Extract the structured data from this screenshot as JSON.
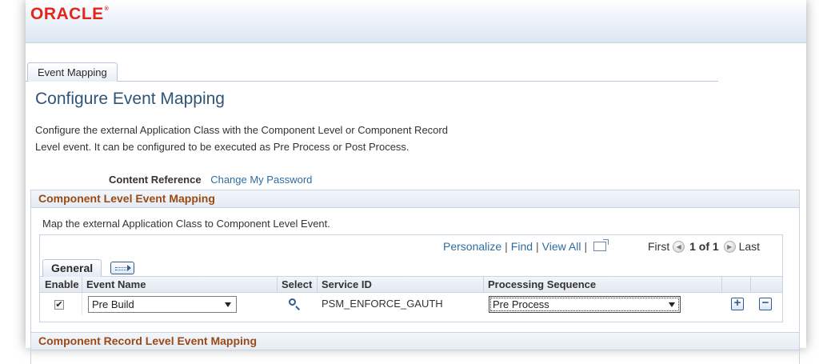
{
  "header": {
    "logo": "ORACLE",
    "logo_mark": "®"
  },
  "tabs": {
    "event_mapping": "Event Mapping"
  },
  "page": {
    "title": "Configure Event Mapping",
    "description": "Configure the external Application Class with the Component Level or Component Record Level event. It can be configured to be executed as Pre Process or Post Process.",
    "content_reference_label": "Content Reference",
    "content_reference_value": "Change My Password"
  },
  "component_level": {
    "title": "Component Level Event Mapping",
    "description": "Map the external Application Class to Component Level Event.",
    "grid": {
      "nav": {
        "personalize": "Personalize",
        "find": "Find",
        "view_all": "View All",
        "sep": "|",
        "first": "First",
        "count": "1 of 1",
        "last": "Last"
      },
      "tab_general": "General",
      "columns": {
        "enable": "Enable",
        "event_name": "Event Name",
        "select": "Select",
        "service_id": "Service ID",
        "processing_sequence": "Processing Sequence"
      },
      "rows": [
        {
          "enabled": "✔",
          "event_name": "Pre Build",
          "service_id": "PSM_ENFORCE_GAUTH",
          "processing_sequence": "Pre Process"
        }
      ],
      "add_symbol": "+",
      "remove_symbol": "−"
    }
  },
  "component_record_level": {
    "title": "Component Record Level Event Mapping"
  },
  "colors": {
    "brand_red": "#e2261b",
    "section_title": "#9a4a14",
    "link": "#2d6ca2",
    "page_title": "#2f5475"
  }
}
